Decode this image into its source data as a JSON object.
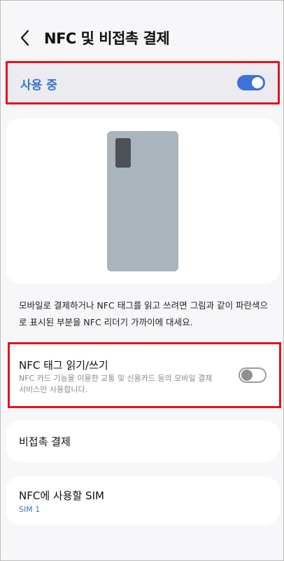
{
  "header": {
    "title": "NFC 및 비접촉 결제",
    "back_icon": "chevron-left-icon"
  },
  "master_switch": {
    "label": "사용 중",
    "state": "on",
    "accent": "#3b73d9"
  },
  "description": "모바일로 결제하거나 NFC 태그를 읽고 쓰려면 그림과 같이 파란색으로 표시된 부분을 NFC 리더기 가까이에 대세요.",
  "nfc_tag": {
    "title": "NFC 태그 읽기/쓰기",
    "subtitle": "NFC 카드 기능을 이용한 교통 및 신용카드 등의 모바일 결제서비스만 사용합니다.",
    "state": "off"
  },
  "contactless_payment": {
    "label": "비접촉 결제"
  },
  "sim": {
    "label": "NFC에 사용할 SIM",
    "value": "SIM 1"
  },
  "colors": {
    "highlight": "#e4121f",
    "background": "#f7f6f9",
    "link": "#3a73c8"
  }
}
